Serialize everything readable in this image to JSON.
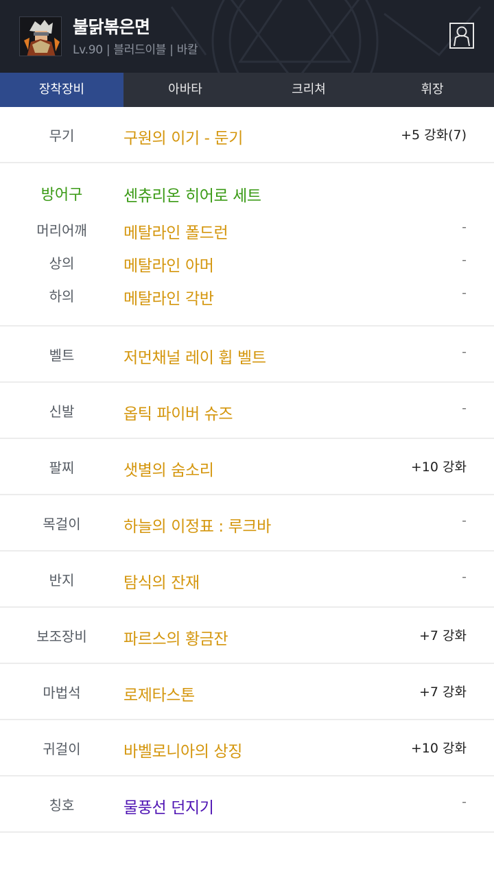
{
  "header": {
    "name": "불닭볶은면",
    "sub": "Lv.90 | 블러드이블 | 바칼"
  },
  "tabs": [
    "장착장비",
    "아바타",
    "크리쳐",
    "휘장"
  ],
  "weapon": {
    "slot": "무기",
    "item": "구원의 이기 - 둔기",
    "enh": "+5 강화(7)"
  },
  "armor": {
    "slot": "방어구",
    "set": "센츄리온 히어로 세트",
    "pieces": [
      {
        "slot": "머리어깨",
        "item": "메탈라인 폴드런",
        "enh": "-"
      },
      {
        "slot": "상의",
        "item": "메탈라인 아머",
        "enh": "-"
      },
      {
        "slot": "하의",
        "item": "메탈라인 각반",
        "enh": "-"
      }
    ]
  },
  "rows": [
    {
      "slot": "벨트",
      "item": "저먼채널 레이 휩 벨트",
      "enh": "-"
    },
    {
      "slot": "신발",
      "item": "옵틱 파이버 슈즈",
      "enh": "-"
    },
    {
      "slot": "팔찌",
      "item": "샛별의 숨소리",
      "enh": "+10 강화"
    },
    {
      "slot": "목걸이",
      "item": "하늘의 이정표 : 루크바",
      "enh": "-"
    },
    {
      "slot": "반지",
      "item": "탐식의 잔재",
      "enh": "-"
    },
    {
      "slot": "보조장비",
      "item": "파르스의 황금잔",
      "enh": "+7 강화"
    },
    {
      "slot": "마법석",
      "item": "로제타스톤",
      "enh": "+7 강화"
    },
    {
      "slot": "귀걸이",
      "item": "바벨로니아의 상징",
      "enh": "+10 강화"
    },
    {
      "slot": "칭호",
      "item": "물풍선 던지기",
      "enh": "-"
    }
  ],
  "colors": {
    "header_bg": "#1f232c",
    "tab_active": "#2e4a8c",
    "unique_item": "#d4960d",
    "set_green": "#3a9a15",
    "title_purple": "#4e13b3"
  },
  "icons": {
    "avatar": "character-portrait",
    "profile": "person-icon"
  }
}
